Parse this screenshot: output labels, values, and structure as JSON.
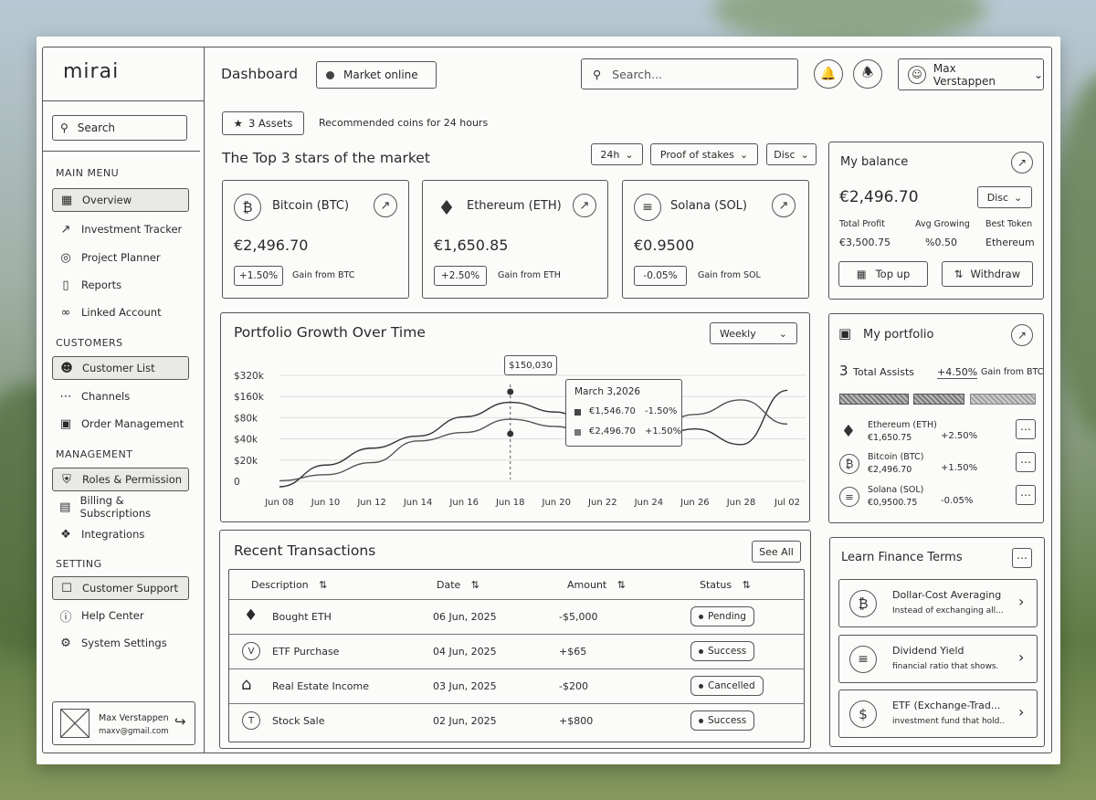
{
  "app": {
    "logo": "mirai",
    "title": "Dashboard",
    "status": "Market online",
    "search_placeholder": "Search...",
    "user_name": "Max Verstappen"
  },
  "sidebar": {
    "search_placeholder": "Search",
    "sections": [
      {
        "label": "MAIN MENU",
        "items": [
          "Overview",
          "Investment Tracker",
          "Project Planner",
          "Reports",
          "Linked Account"
        ]
      },
      {
        "label": "CUSTOMERS",
        "items": [
          "Customer List",
          "Channels",
          "Order Management"
        ]
      },
      {
        "label": "MANAGEMENT",
        "items": [
          "Roles & Permission",
          "Billing & Subscriptions",
          "Integrations"
        ]
      },
      {
        "label": "SETTING",
        "items": [
          "Customer Support",
          "Help Center",
          "System Settings"
        ]
      }
    ],
    "profile": {
      "name": "Max Verstappen",
      "email": "maxv@gmail.com"
    }
  },
  "assets_bar": {
    "badge": "3 Assets",
    "note": "Recommended coins for 24 hours"
  },
  "top": {
    "title": "The Top 3 stars of the market",
    "filters": [
      "24h",
      "Proof of stakes",
      "Disc"
    ],
    "cards": [
      {
        "name": "Bitcoin (BTC)",
        "value": "€2,496.70",
        "change": "+1.50%",
        "note": "Gain from BTC",
        "icon": "bitcoin-icon"
      },
      {
        "name": "Ethereum (ETH)",
        "value": "€1,650.85",
        "change": "+2.50%",
        "note": "Gain from ETH",
        "icon": "ethereum-icon"
      },
      {
        "name": "Solana (SOL)",
        "value": "€0.9500",
        "change": "-0.05%",
        "note": "Gain from SOL",
        "icon": "solana-icon"
      }
    ]
  },
  "balance": {
    "title": "My balance",
    "value": "€2,496.70",
    "currency": "Disc",
    "stats": [
      {
        "label": "Total Profit",
        "value": "€3,500.75"
      },
      {
        "label": "Avg Growing",
        "value": "%0.50"
      },
      {
        "label": "Best Token",
        "value": "Ethereum"
      }
    ],
    "topup": "Top up",
    "withdraw": "Withdraw"
  },
  "chart": {
    "title": "Portfolio Growth Over Time",
    "period": "Weekly",
    "peak_label": "$150,030",
    "tooltip": {
      "date": "March 3,2026",
      "rows": [
        {
          "value": "€1,546.70",
          "change": "-1.50%"
        },
        {
          "value": "€2,496.70",
          "change": "+1.50%"
        }
      ]
    }
  },
  "chart_data": {
    "type": "line",
    "title": "Portfolio Growth Over Time",
    "y_ticks": [
      "$320k",
      "$160k",
      "$80k",
      "$40k",
      "$20k",
      "0"
    ],
    "x_ticks": [
      "Jun 08",
      "Jun 10",
      "Jun 12",
      "Jun 14",
      "Jun 16",
      "Jun 18",
      "Jun 20",
      "Jun 22",
      "Jun 24",
      "Jun 26",
      "Jun 28",
      "Jul 02"
    ],
    "series": [
      {
        "values": [
          0,
          18,
          32,
          42,
          58,
          70,
          62,
          40,
          38,
          48,
          35,
          80
        ]
      },
      {
        "values": [
          5,
          10,
          20,
          38,
          45,
          56,
          50,
          35,
          45,
          60,
          72,
          52
        ]
      }
    ]
  },
  "portfolio": {
    "title": "My portfolio",
    "count": "3",
    "count_label": "Total Assists",
    "change": "+4.50%",
    "note": "Gain from BTC",
    "items": [
      {
        "name": "Ethereum (ETH)",
        "value": "€1,650.75",
        "change": "+2.50%",
        "icon": "ethereum-icon"
      },
      {
        "name": "Bitcoin (BTC)",
        "value": "€2,496.70",
        "change": "+1.50%",
        "icon": "bitcoin-icon"
      },
      {
        "name": "Solana (SOL)",
        "value": "€0,9500.75",
        "change": "-0.05%",
        "icon": "solana-icon"
      }
    ]
  },
  "transactions": {
    "title": "Recent Transactions",
    "see_all": "See All",
    "columns": [
      "Description",
      "Date",
      "Amount",
      "Status"
    ],
    "rows": [
      {
        "desc": "Bought ETH",
        "date": "06 Jun, 2025",
        "amount": "-$5,000",
        "status": "Pending"
      },
      {
        "desc": "ETF Purchase",
        "date": "04 Jun, 2025",
        "amount": "+$65",
        "status": "Success"
      },
      {
        "desc": "Real Estate Income",
        "date": "03 Jun, 2025",
        "amount": "-$200",
        "status": "Cancelled"
      },
      {
        "desc": "Stock Sale",
        "date": "02 Jun, 2025",
        "amount": "+$800",
        "status": "Success"
      }
    ]
  },
  "terms": {
    "title": "Learn Finance Terms",
    "items": [
      {
        "title": "Dollar-Cost Averaging",
        "desc": "Instead of exchanging all..."
      },
      {
        "title": "Dividend Yield",
        "desc": "financial ratio that shows."
      },
      {
        "title": "ETF (Exchange-Trad...",
        "desc": "investment fund that hold.."
      }
    ]
  }
}
